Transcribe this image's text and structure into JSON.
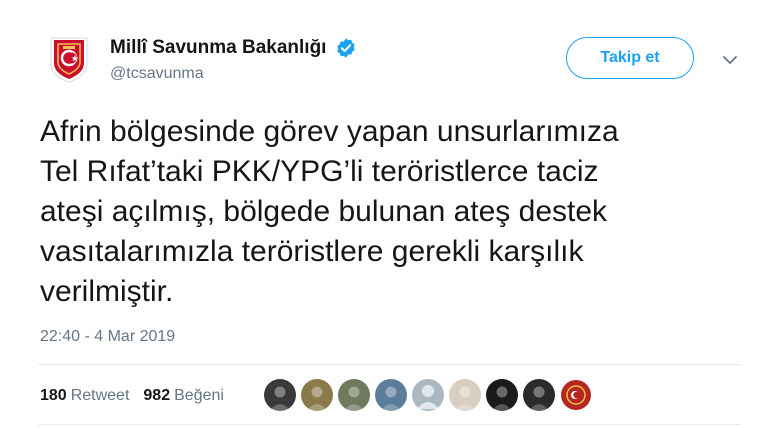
{
  "account": {
    "display_name": "Millî Savunma Bakanlığı",
    "handle": "@tcsavunma",
    "verified": true,
    "avatar_icon": "ministry-emblem-icon"
  },
  "follow_button": {
    "label": "Takip et"
  },
  "tweet": {
    "text": "Afrin bölgesinde görev yapan unsurlarımıza\nTel Rıfat’taki PKK/YPG’li teröristlerce taciz\nateşi açılmış, bölgede bulunan ateş destek\nvasıtalarımızla teröristlere gerekli karşılık\nverilmiştir.",
    "timestamp": "22:40 - 4 Mar 2019"
  },
  "stats": {
    "retweets_count": "180",
    "retweets_label": "Retweet",
    "likes_count": "982",
    "likes_label": "Beğeni"
  },
  "likers": [
    {
      "name": "liker-avatar-1",
      "color": "#3a3a3a"
    },
    {
      "name": "liker-avatar-2",
      "color": "#8a7a4a"
    },
    {
      "name": "liker-avatar-3",
      "color": "#6d7a5c"
    },
    {
      "name": "liker-avatar-4",
      "color": "#5b7d9a"
    },
    {
      "name": "liker-avatar-5",
      "color": "#aab8c2"
    },
    {
      "name": "liker-avatar-6",
      "color": "#d9cfc0"
    },
    {
      "name": "liker-avatar-7",
      "color": "#1a1a1a"
    },
    {
      "name": "liker-avatar-8",
      "color": "#2b2b2b"
    },
    {
      "name": "liker-avatar-9",
      "color": "#b5271f"
    }
  ],
  "colors": {
    "accent": "#1da1f2",
    "secondary_text": "#657786",
    "divider": "#e6ecf0",
    "emblem_red": "#c8102e"
  }
}
